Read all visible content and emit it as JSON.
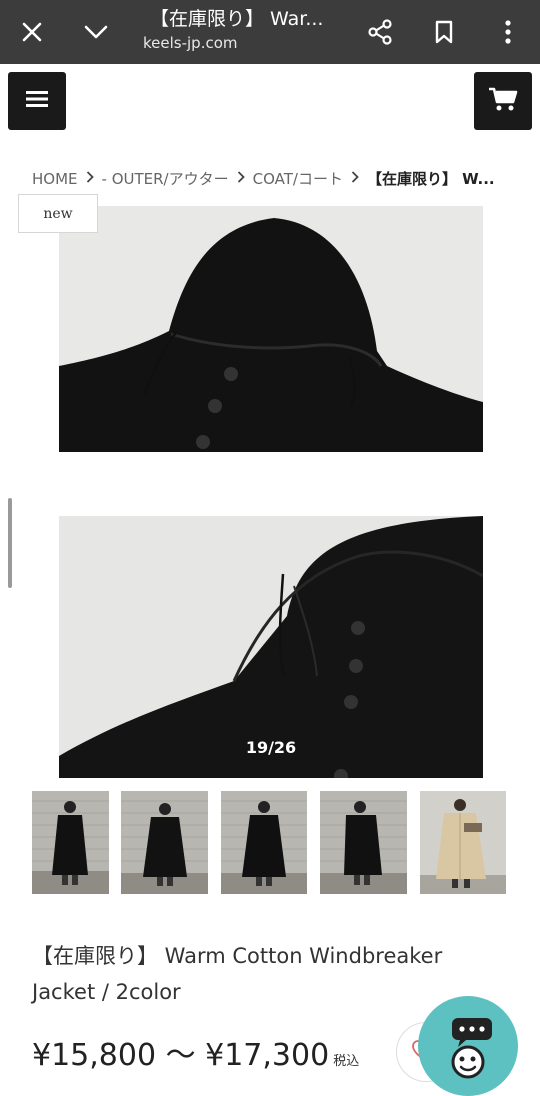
{
  "browser": {
    "title": "【在庫限り】 War...",
    "url": "keels-jp.com",
    "icons": [
      "close-icon",
      "chevron-down-icon",
      "share-icon",
      "bookmark-icon",
      "more-vert-icon"
    ]
  },
  "header": {
    "menu_icon": "hamburger-icon",
    "cart_icon": "cart-icon"
  },
  "breadcrumb": {
    "items": [
      "HOME",
      "- OUTER/アウター",
      "COAT/コート"
    ],
    "current": "【在庫限り】 W..."
  },
  "badge": {
    "label": "new"
  },
  "gallery": {
    "counter": "19/26",
    "thumbnail_count": 5
  },
  "product": {
    "title": "【在庫限り】 Warm Cotton Windbreaker Jacket / 2color",
    "price": "¥15,800 〜 ¥17,300",
    "tax_label": "税込"
  },
  "colors": {
    "accent": "#5cc1c0",
    "browser_bar": "#3c3c3c",
    "button_dark": "#1a1a1a"
  }
}
